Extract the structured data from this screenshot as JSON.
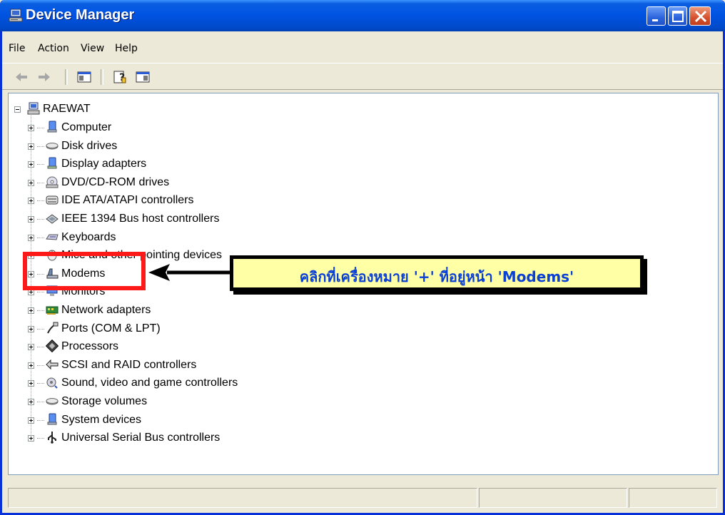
{
  "window": {
    "title": "Device Manager"
  },
  "menu": [
    "File",
    "Action",
    "View",
    "Help"
  ],
  "toolbar": [
    "back-arrow-icon",
    "forward-arrow-icon",
    "show-hide-console-tree-icon",
    "help-icon",
    "properties-pane-icon"
  ],
  "tree": {
    "root": {
      "label": "RAEWAT",
      "icon": "computer-icon",
      "expanded": true
    },
    "items": [
      {
        "label": "Computer",
        "icon": "computer-icon"
      },
      {
        "label": "Disk drives",
        "icon": "disk-drive-icon"
      },
      {
        "label": "Display adapters",
        "icon": "display-adapter-icon"
      },
      {
        "label": "DVD/CD-ROM drives",
        "icon": "cd-drive-icon"
      },
      {
        "label": "IDE ATA/ATAPI controllers",
        "icon": "ide-controller-icon"
      },
      {
        "label": "IEEE 1394 Bus host controllers",
        "icon": "ieee1394-icon"
      },
      {
        "label": "Keyboards",
        "icon": "keyboard-icon"
      },
      {
        "label": "Mice and other pointing devices",
        "icon": "mouse-icon"
      },
      {
        "label": "Modems",
        "icon": "modem-icon"
      },
      {
        "label": "Monitors",
        "icon": "monitor-icon"
      },
      {
        "label": "Network adapters",
        "icon": "network-adapter-icon"
      },
      {
        "label": "Ports (COM & LPT)",
        "icon": "port-icon"
      },
      {
        "label": "Processors",
        "icon": "processor-icon"
      },
      {
        "label": "SCSI and RAID controllers",
        "icon": "scsi-icon"
      },
      {
        "label": "Sound, video and game controllers",
        "icon": "sound-icon"
      },
      {
        "label": "Storage volumes",
        "icon": "storage-volume-icon"
      },
      {
        "label": "System devices",
        "icon": "system-device-icon"
      },
      {
        "label": "Universal Serial Bus controllers",
        "icon": "usb-icon"
      }
    ]
  },
  "annotation": {
    "callout_text": "คลิกที่เครื่องหมาย '+' ที่อยู่หน้า 'Modems'",
    "highlight_color": "#ff1a1a",
    "callout_bg": "#ffffa6",
    "callout_text_color": "#0a3fd6"
  },
  "colors": {
    "titlebar": "#0054e3",
    "face": "#ece9d8"
  }
}
